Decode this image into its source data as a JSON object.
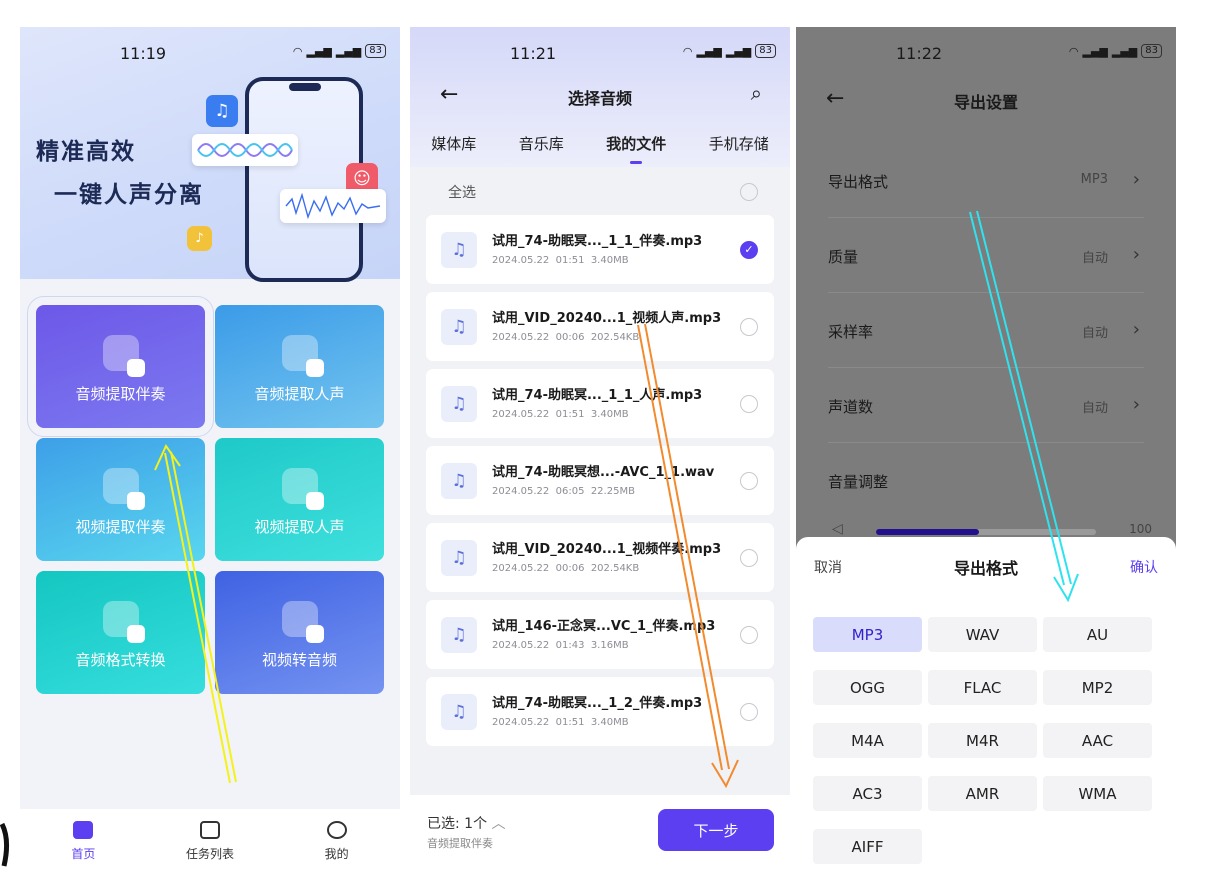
{
  "screen1": {
    "time": "11:19",
    "battery": "83",
    "banner": {
      "line1": "精准高效",
      "line2": "一键人声分离"
    },
    "tiles": [
      {
        "label": "音频提取伴奏"
      },
      {
        "label": "音频提取人声"
      },
      {
        "label": "视频提取伴奏"
      },
      {
        "label": "视频提取人声"
      },
      {
        "label": "音频格式转换"
      },
      {
        "label": "视频转音频"
      }
    ],
    "tabbar": [
      {
        "label": "首页",
        "active": true
      },
      {
        "label": "任务列表"
      },
      {
        "label": "我的"
      }
    ]
  },
  "screen2": {
    "time": "11:21",
    "battery": "83",
    "title": "选择音频",
    "tabs": [
      "媒体库",
      "音乐库",
      "我的文件",
      "手机存储"
    ],
    "active_tab": "我的文件",
    "select_all": "全选",
    "files": [
      {
        "name": "试用_74-助眠冥..._1_1_伴奏.mp3",
        "date": "2024.05.22",
        "time": "01:51",
        "size": "3.40MB",
        "checked": true
      },
      {
        "name": "试用_VID_20240...1_视频人声.mp3",
        "date": "2024.05.22",
        "time": "00:06",
        "size": "202.54KB",
        "checked": false
      },
      {
        "name": "试用_74-助眠冥..._1_1_人声.mp3",
        "date": "2024.05.22",
        "time": "01:51",
        "size": "3.40MB",
        "checked": false
      },
      {
        "name": "试用_74-助眠冥想...-AVC_1_1.wav",
        "date": "2024.05.22",
        "time": "06:05",
        "size": "22.25MB",
        "checked": false
      },
      {
        "name": "试用_VID_20240...1_视频伴奏.mp3",
        "date": "2024.05.22",
        "time": "00:06",
        "size": "202.54KB",
        "checked": false
      },
      {
        "name": "试用_146-正念冥...VC_1_伴奏.mp3",
        "date": "2024.05.22",
        "time": "01:43",
        "size": "3.16MB",
        "checked": false
      },
      {
        "name": "试用_74-助眠冥..._1_2_伴奏.mp3",
        "date": "2024.05.22",
        "time": "01:51",
        "size": "3.40MB",
        "checked": false
      }
    ],
    "footer": {
      "selected": "已选: 1个",
      "task": "音频提取伴奏",
      "next": "下一步"
    }
  },
  "screen3": {
    "time": "11:22",
    "battery": "83",
    "title": "导出设置",
    "rows": [
      {
        "label": "导出格式",
        "value": "MP3"
      },
      {
        "label": "质量",
        "value": "自动"
      },
      {
        "label": "采样率",
        "value": "自动"
      },
      {
        "label": "声道数",
        "value": "自动"
      },
      {
        "label": "音量调整",
        "value": ""
      }
    ],
    "volume": {
      "value": 100,
      "fill_fraction": 0.47,
      "label": "100"
    },
    "sheet": {
      "cancel": "取消",
      "title": "导出格式",
      "confirm": "确认",
      "formats": [
        "MP3",
        "WAV",
        "AU",
        "OGG",
        "FLAC",
        "MP2",
        "M4A",
        "M4R",
        "AAC",
        "AC3",
        "AMR",
        "WMA",
        "AIFF"
      ],
      "selected": "MP3"
    }
  },
  "colors": {
    "accent": "#5b3ff0",
    "arrow_yellow": "#f4f21a",
    "arrow_orange": "#f28a2e",
    "arrow_cyan": "#2fe3ee"
  }
}
